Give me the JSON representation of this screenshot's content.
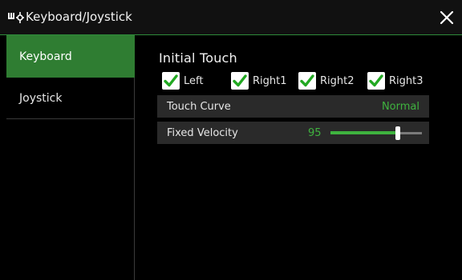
{
  "window": {
    "title": "Keyboard/Joystick",
    "icon": "keyboard-joystick-icon",
    "close_icon": "close-icon"
  },
  "sidebar": {
    "items": [
      {
        "label": "Keyboard",
        "active": true
      },
      {
        "label": "Joystick",
        "active": false
      }
    ]
  },
  "main": {
    "section_title": "Initial Touch",
    "checkboxes": [
      {
        "label": "Left",
        "checked": true
      },
      {
        "label": "Right1",
        "checked": true
      },
      {
        "label": "Right2",
        "checked": true
      },
      {
        "label": "Right3",
        "checked": true
      }
    ],
    "touch_curve": {
      "label": "Touch Curve",
      "value": "Normal"
    },
    "fixed_velocity": {
      "label": "Fixed Velocity",
      "value": "95",
      "level": 0.74
    }
  },
  "colors": {
    "accent": "#2f7d32",
    "value_green": "#3fb33f",
    "check_green": "#22a822"
  }
}
